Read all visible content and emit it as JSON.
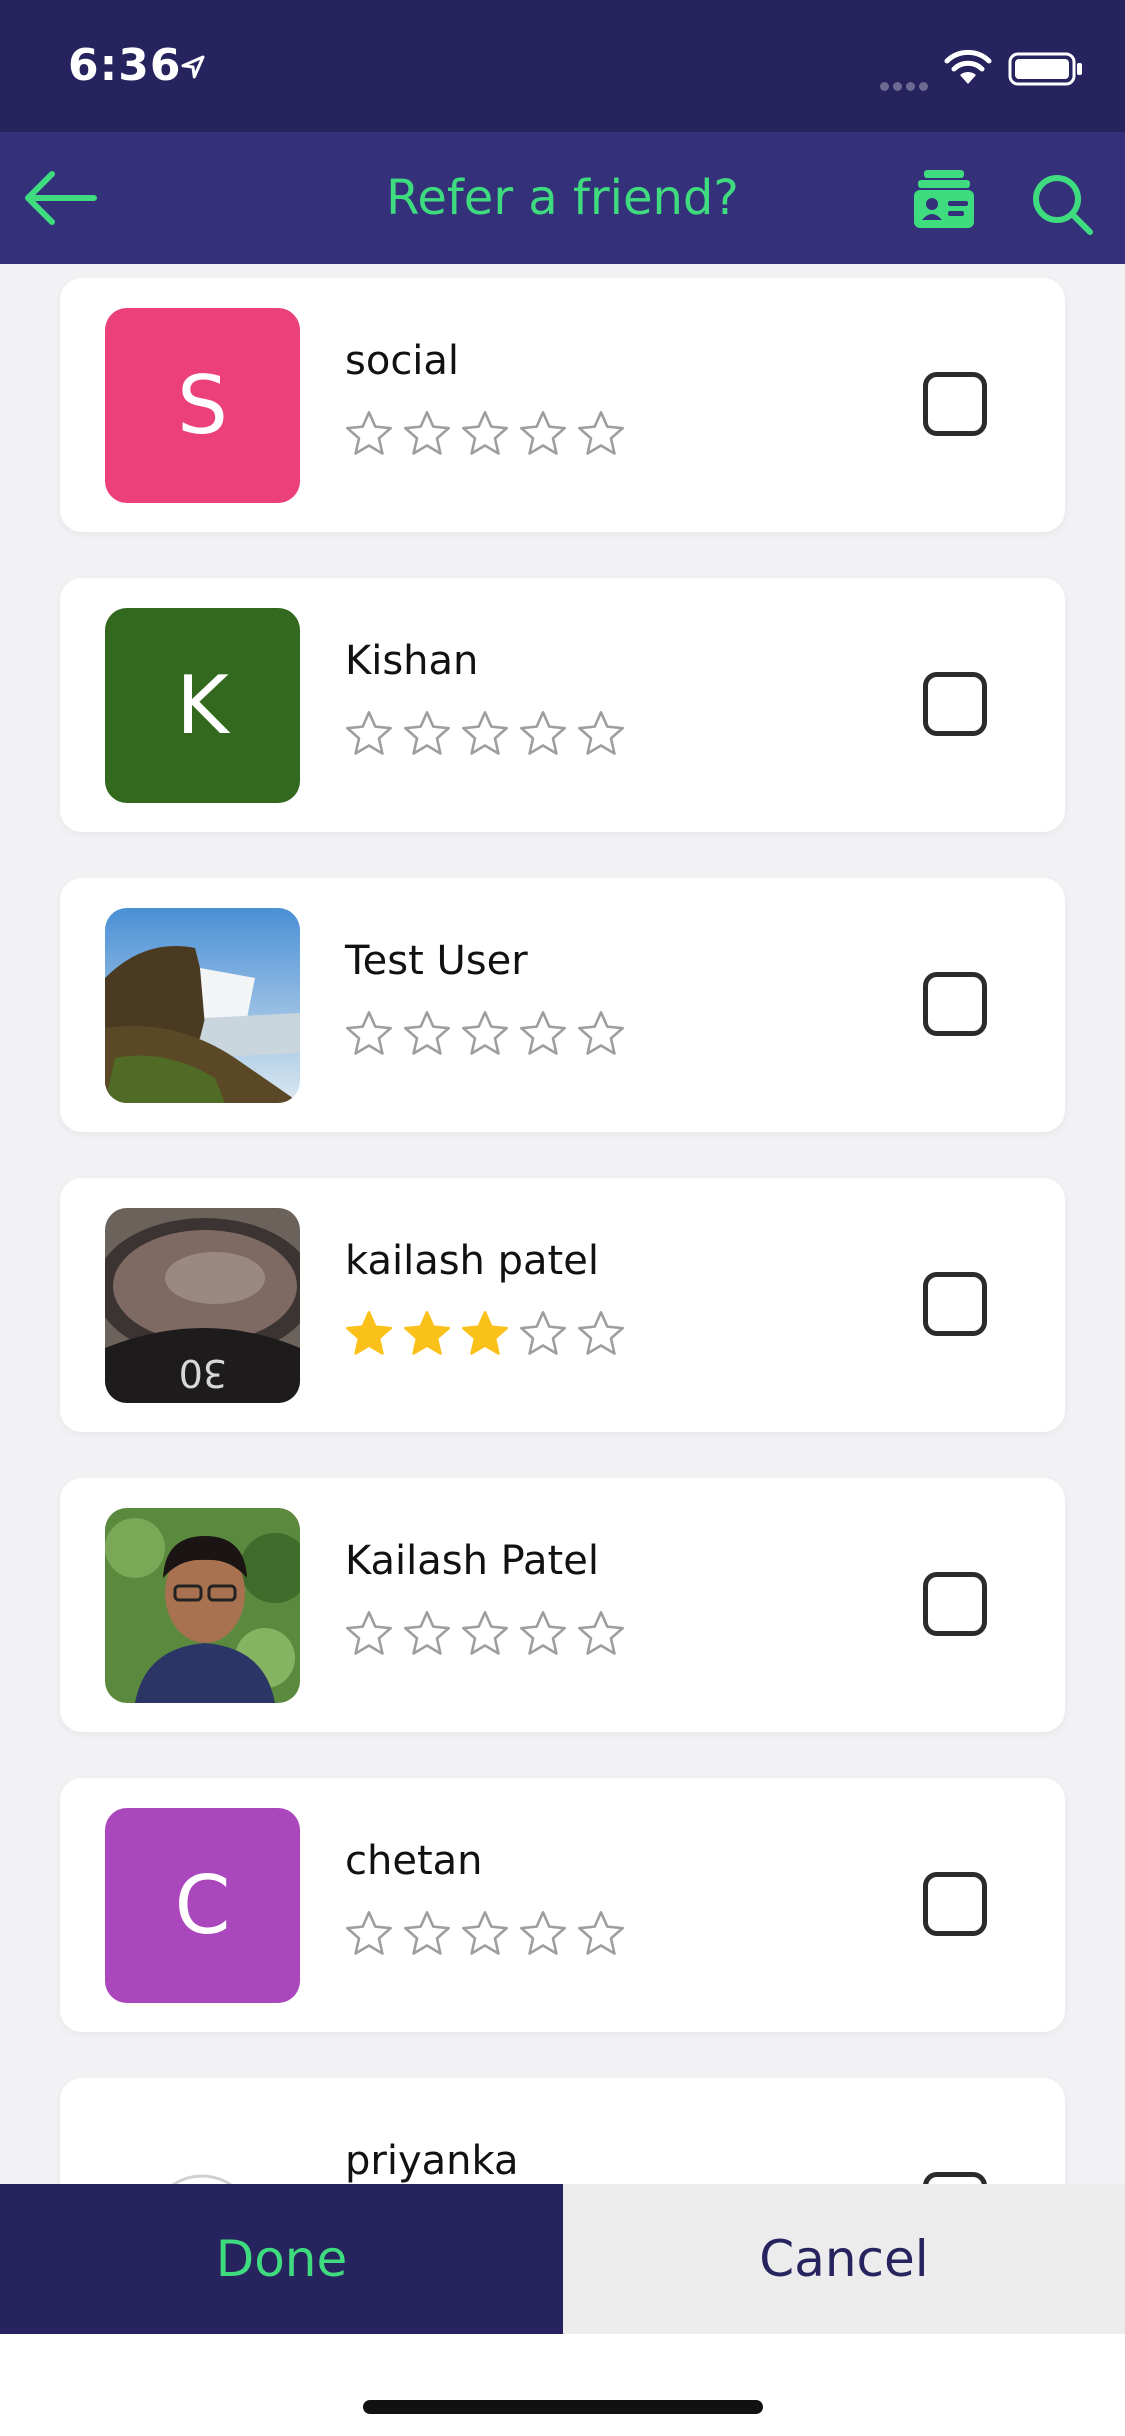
{
  "status_bar": {
    "time": "6:36"
  },
  "nav": {
    "title": "Refer a friend?"
  },
  "contacts": [
    {
      "name": "social",
      "initial": "S",
      "avatar_color": "#ec407a",
      "avatar_type": "initial",
      "rating": 0,
      "checked": false
    },
    {
      "name": "Kishan",
      "initial": "K",
      "avatar_color": "#33691e",
      "avatar_type": "initial",
      "rating": 0,
      "checked": false
    },
    {
      "name": "Test User",
      "initial": "",
      "avatar_color": "#5a6e3a",
      "avatar_type": "photo-landscape",
      "rating": 0,
      "checked": false
    },
    {
      "name": "kailash patel",
      "initial": "",
      "avatar_color": "#3a3a3a",
      "avatar_type": "photo-watch",
      "rating": 3,
      "checked": false
    },
    {
      "name": "Kailash Patel",
      "initial": "",
      "avatar_color": "#4c7a3a",
      "avatar_type": "photo-person",
      "rating": 0,
      "checked": false
    },
    {
      "name": "chetan",
      "initial": "C",
      "avatar_color": "#ab47bc",
      "avatar_type": "initial",
      "rating": 0,
      "checked": false
    },
    {
      "name": "priyanka",
      "initial": "",
      "avatar_color": "#e0e0e0",
      "avatar_type": "placeholder-group",
      "rating": 0,
      "checked": false
    }
  ],
  "footer": {
    "done_label": "Done",
    "cancel_label": "Cancel"
  },
  "colors": {
    "primary": "#27235e",
    "navbar": "#34317a",
    "accent": "#3fdc7f",
    "star_filled": "#fbc11b",
    "star_empty": "#9e9e9e"
  },
  "icons": {
    "back": "arrow-left-icon",
    "contacts": "contact-card-icon",
    "search": "search-icon"
  }
}
